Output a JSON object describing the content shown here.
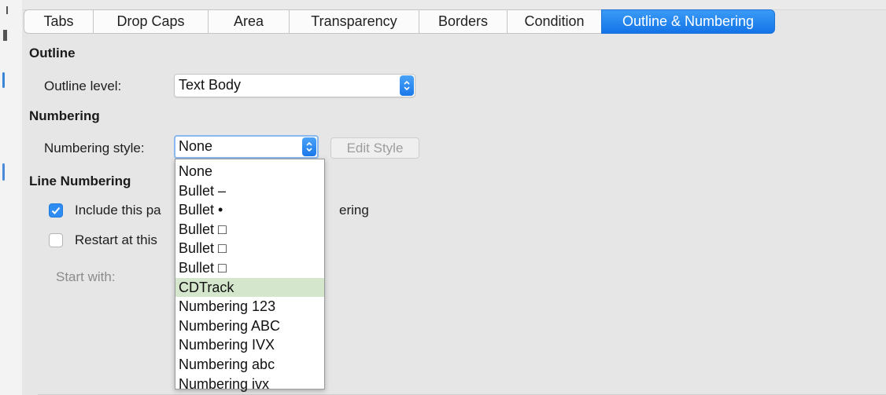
{
  "tabs": [
    {
      "label": "Tabs",
      "active": false
    },
    {
      "label": "Drop Caps",
      "active": false
    },
    {
      "label": "Area",
      "active": false
    },
    {
      "label": "Transparency",
      "active": false
    },
    {
      "label": "Borders",
      "active": false
    },
    {
      "label": "Condition",
      "active": false
    },
    {
      "label": "Outline & Numbering",
      "active": true
    }
  ],
  "outline": {
    "heading": "Outline",
    "level_label": "Outline level:",
    "level_value": "Text Body"
  },
  "numbering": {
    "heading": "Numbering",
    "style_label": "Numbering style:",
    "style_value": "None",
    "edit_style_label": "Edit Style",
    "options": [
      "None",
      "Bullet –",
      "Bullet •",
      "Bullet □",
      "Bullet □",
      "Bullet □",
      "CDTrack",
      "Numbering 123",
      "Numbering ABC",
      "Numbering IVX",
      "Numbering abc",
      "Numbering ivx"
    ],
    "highlighted_option": "CDTrack"
  },
  "line_numbering": {
    "heading": "Line Numbering",
    "include_label_left": "Include this pa",
    "include_label_right": "ering",
    "include_checked": true,
    "restart_label": "Restart at this",
    "restart_checked": false,
    "start_with_label": "Start with:"
  },
  "colors": {
    "accent": "#1f7ae0",
    "highlight": "#d4e6cc"
  }
}
